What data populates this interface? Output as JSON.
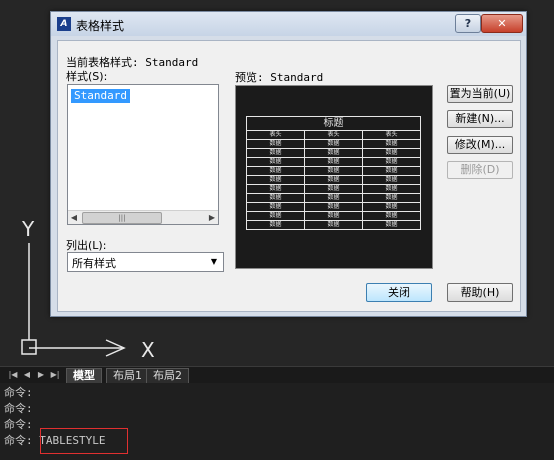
{
  "dialog": {
    "title": "表格样式",
    "help_button": "?",
    "close_button": "✕",
    "current_style_label": "当前表格样式: Standard",
    "styles_label": "样式(S):",
    "styles": [
      "Standard"
    ],
    "list_label": "列出(L):",
    "list_value": "所有样式",
    "preview_label": "预览: Standard",
    "buttons": {
      "set_current": "置为当前(U)",
      "new": "新建(N)...",
      "modify": "修改(M)...",
      "delete": "删除(D)",
      "close": "关闭",
      "help": "帮助(H)"
    },
    "preview_table": {
      "title": "标题",
      "header": [
        "表头",
        "表头",
        "表头"
      ],
      "rows": [
        [
          "数据",
          "数据",
          "数据"
        ],
        [
          "数据",
          "数据",
          "数据"
        ],
        [
          "数据",
          "数据",
          "数据"
        ],
        [
          "数据",
          "数据",
          "数据"
        ],
        [
          "数据",
          "数据",
          "数据"
        ],
        [
          "数据",
          "数据",
          "数据"
        ],
        [
          "数据",
          "数据",
          "数据"
        ],
        [
          "数据",
          "数据",
          "数据"
        ],
        [
          "数据",
          "数据",
          "数据"
        ],
        [
          "数据",
          "数据",
          "数据"
        ]
      ]
    }
  },
  "ucs": {
    "y_label": "Y",
    "x_label": "X"
  },
  "layout_tabs": [
    "模型",
    "布局1",
    "布局2"
  ],
  "command_lines": [
    "命令:",
    "命令:",
    "命令:",
    "命令: TABLESTYLE"
  ],
  "colors": {
    "highlight": "#3399ff",
    "canvas": "#262626",
    "input_border": "#e03030"
  }
}
